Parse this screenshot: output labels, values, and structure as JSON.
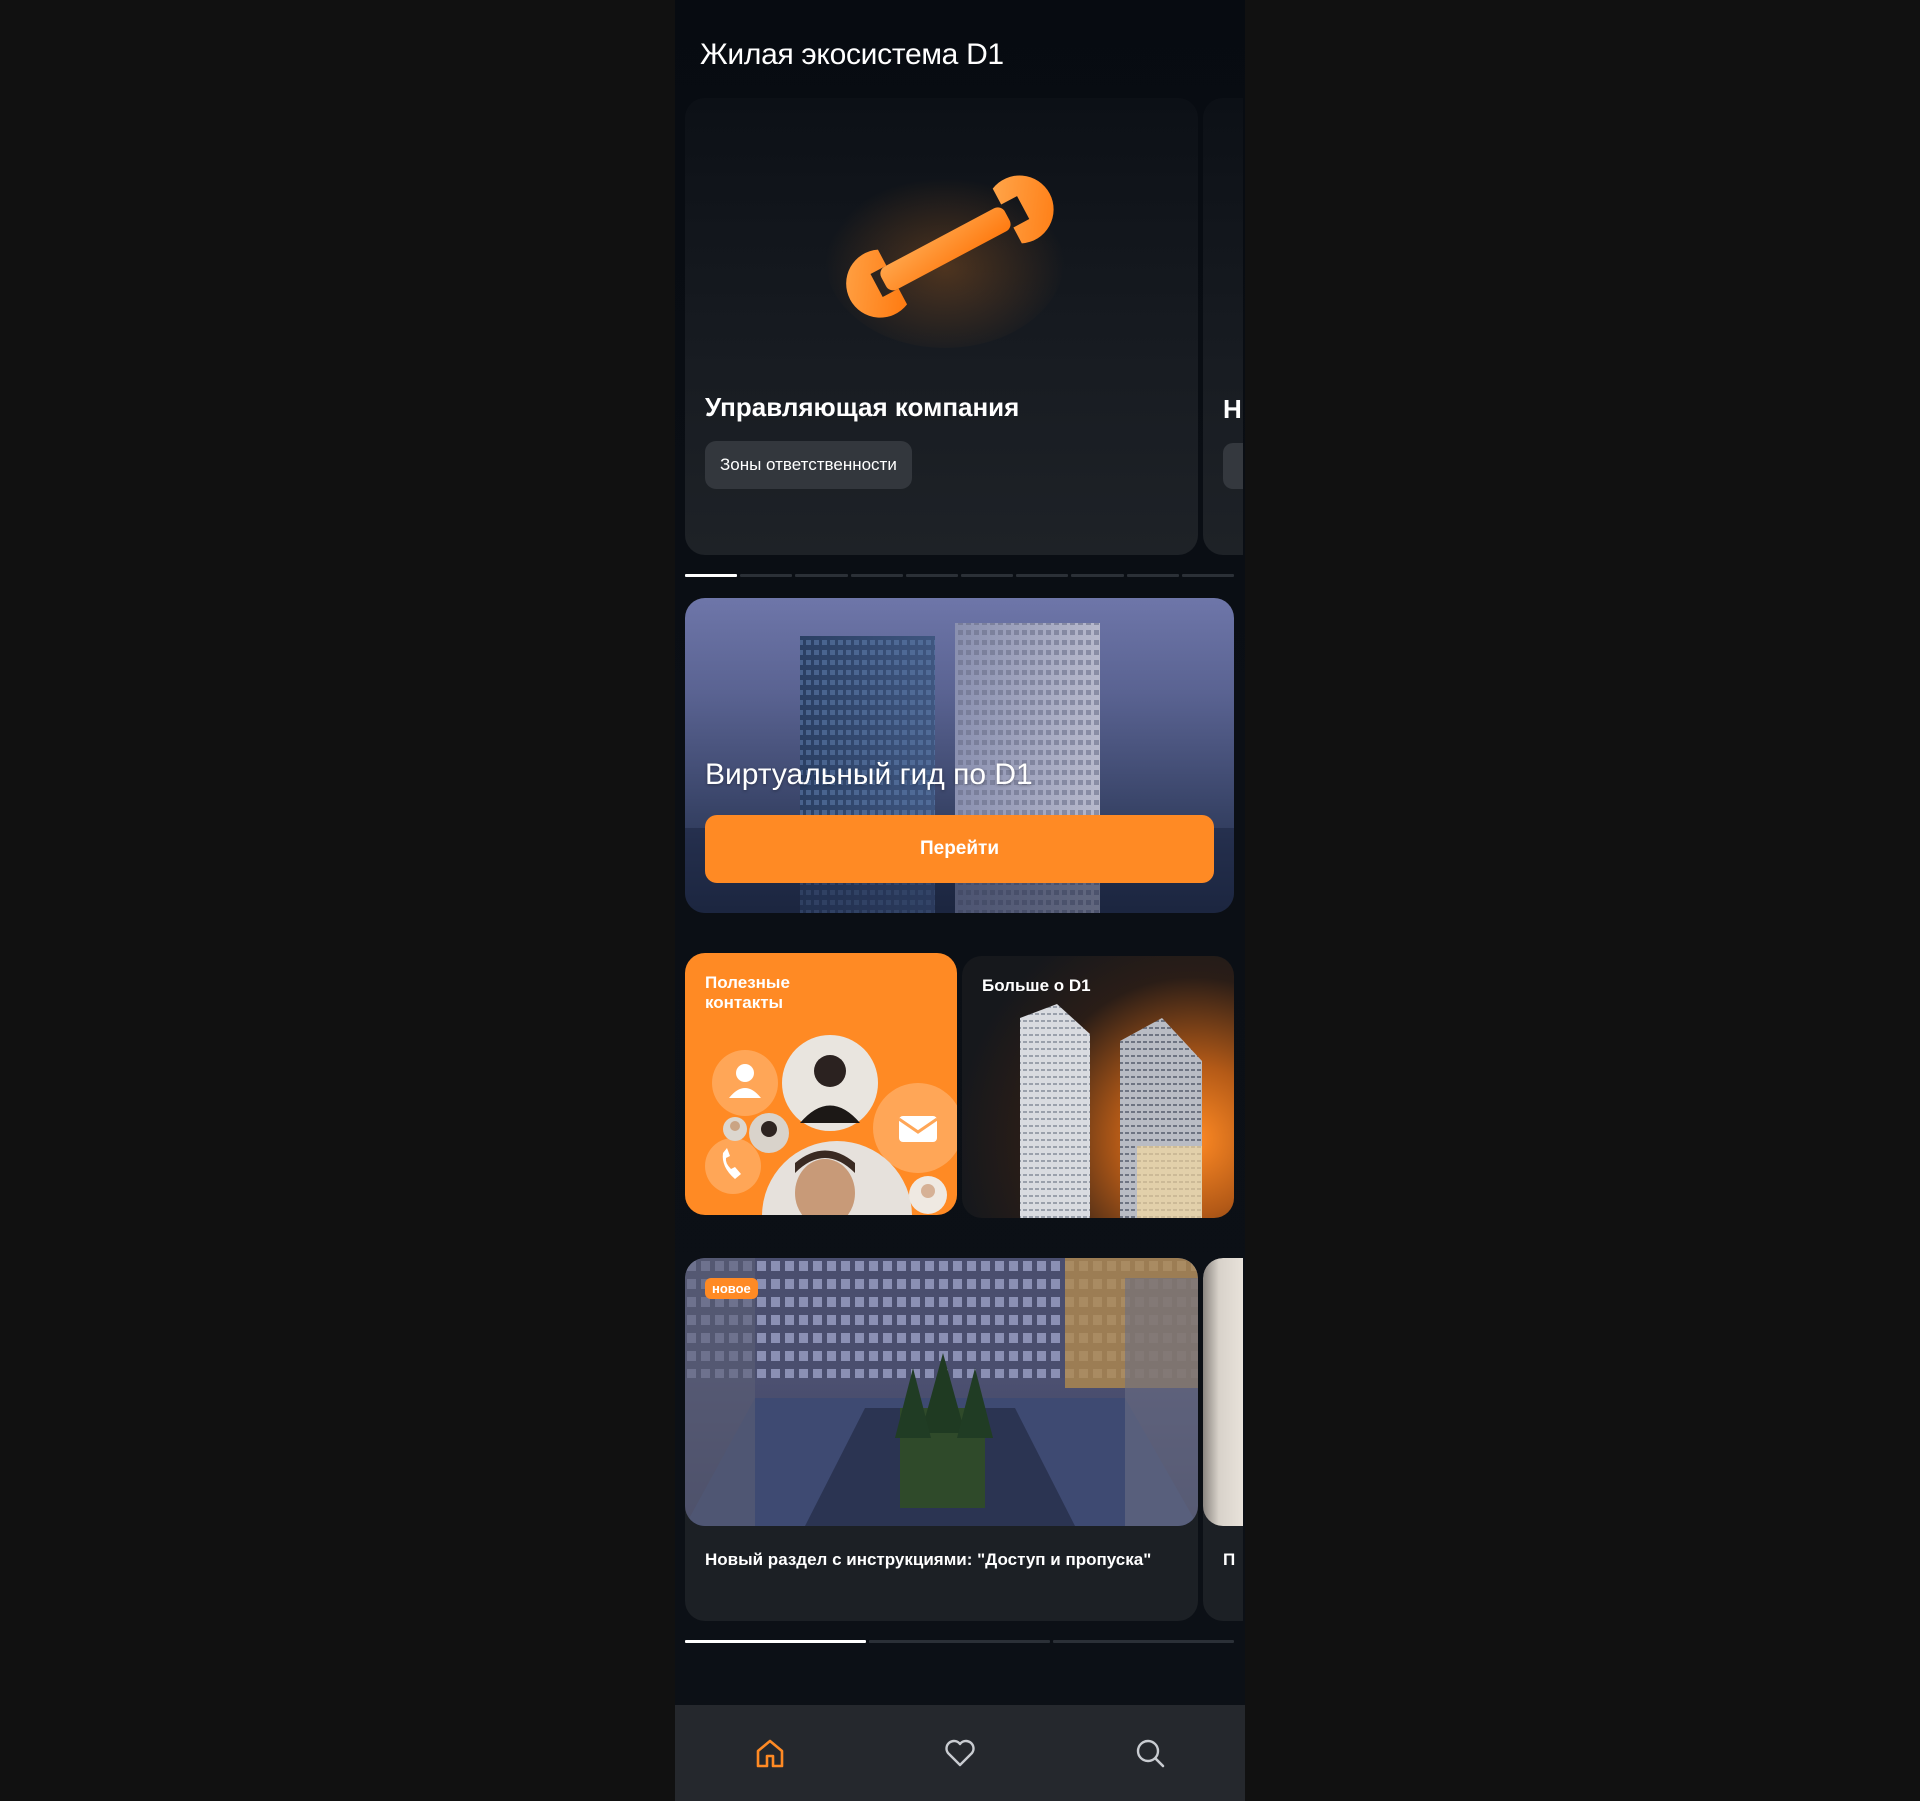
{
  "page": {
    "title": "Жилая экосистема D1"
  },
  "services": {
    "active_index": 0,
    "count": 10,
    "items": [
      {
        "title": "Управляющая компания",
        "chip": "Зоны ответственности",
        "icon": "wrench-icon"
      },
      {
        "title": "Н",
        "chip": ""
      }
    ]
  },
  "guide": {
    "title": "Виртуальный гид по D1",
    "button_label": "Перейти"
  },
  "tiles": {
    "contacts_label": "Полезные контакты",
    "more_label": "Больше о D1"
  },
  "news": {
    "active_index": 0,
    "count": 3,
    "items": [
      {
        "badge": "новое",
        "title": "Новый раздел с инструкциями: \"Доступ и пропуска\""
      },
      {
        "title": "П"
      }
    ]
  },
  "bottom_nav": {
    "items": [
      {
        "icon": "home-icon",
        "active": true
      },
      {
        "icon": "heart-icon",
        "active": false
      },
      {
        "icon": "search-icon",
        "active": false
      }
    ]
  },
  "colors": {
    "accent": "#ff8a24",
    "background": "#111111",
    "screen_background": "#0b0f15",
    "card": "#1c2025",
    "nav": "#25282d"
  }
}
